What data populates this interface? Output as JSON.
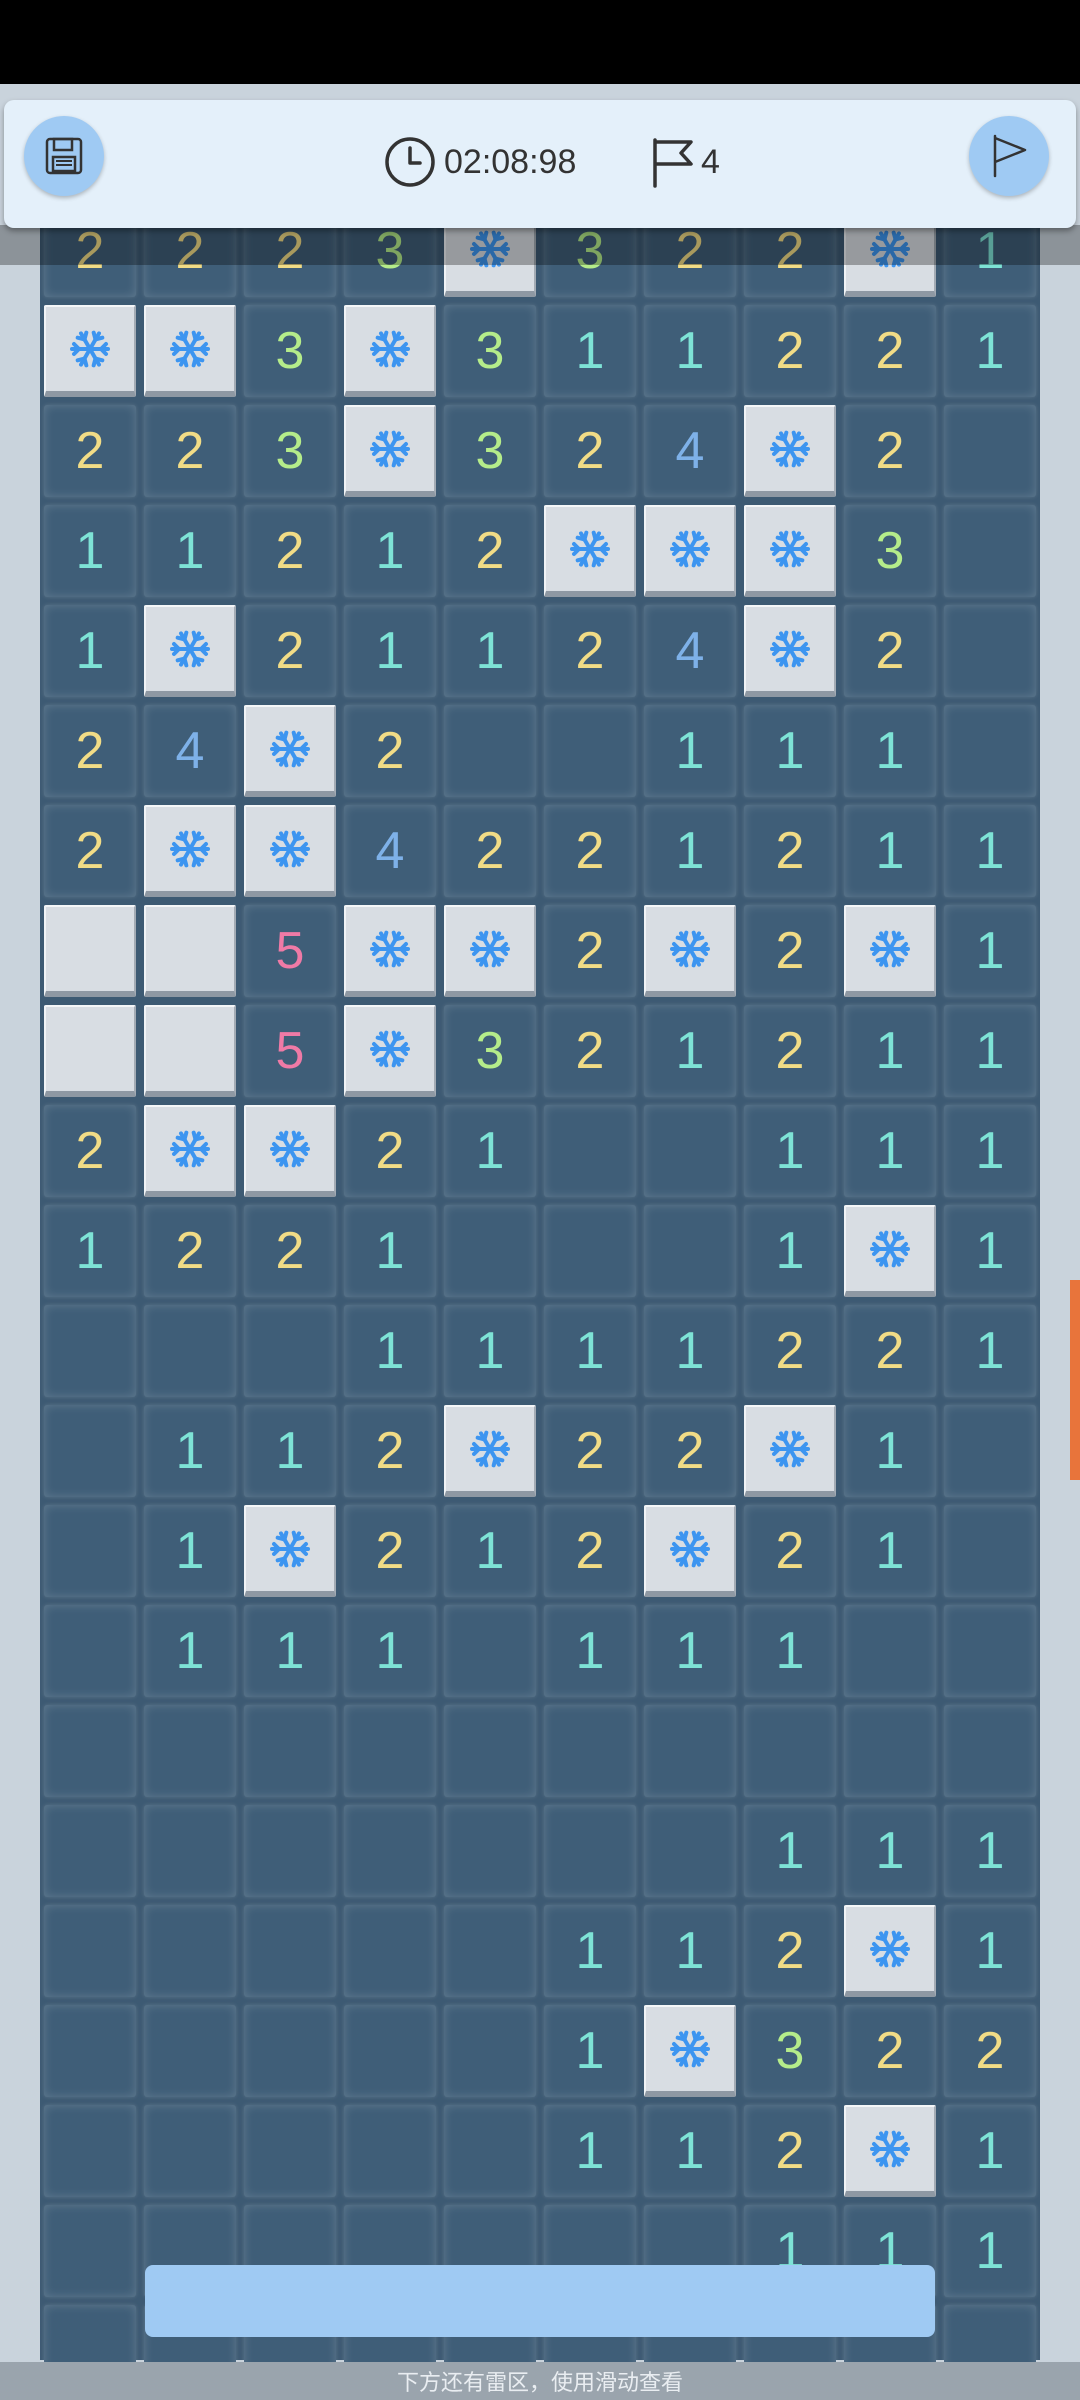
{
  "header": {
    "timer": "02:08:98",
    "flags": "4"
  },
  "board": {
    "cols": 10,
    "rows": [
      [
        "2",
        "2",
        "2",
        "3",
        "M",
        "3",
        "2",
        "2",
        "M",
        "1"
      ],
      [
        "M",
        "M",
        "3",
        "M",
        "3",
        "1",
        "1",
        "2",
        "2",
        "1"
      ],
      [
        "2",
        "2",
        "3",
        "M",
        "3",
        "2",
        "4",
        "M",
        "2",
        ""
      ],
      [
        "1",
        "1",
        "2",
        "1",
        "2",
        "M",
        "M",
        "M",
        "3",
        ""
      ],
      [
        "1",
        "M",
        "2",
        "1",
        "1",
        "2",
        "4",
        "M",
        "2",
        ""
      ],
      [
        "2",
        "4",
        "M",
        "2",
        "",
        "",
        "1",
        "1",
        "1",
        ""
      ],
      [
        "2",
        "M",
        "M",
        "4",
        "2",
        "2",
        "1",
        "2",
        "1",
        "1"
      ],
      [
        "C",
        "C",
        "5",
        "M",
        "M",
        "2",
        "M",
        "2",
        "M",
        "1"
      ],
      [
        "C",
        "C",
        "5",
        "M",
        "3",
        "2",
        "1",
        "2",
        "1",
        "1"
      ],
      [
        "2",
        "M",
        "M",
        "2",
        "1",
        "",
        "",
        "1",
        "1",
        "1"
      ],
      [
        "1",
        "2",
        "2",
        "1",
        "",
        "",
        "",
        "1",
        "M",
        "1"
      ],
      [
        "",
        "",
        "",
        "1",
        "1",
        "1",
        "1",
        "2",
        "2",
        "1"
      ],
      [
        "",
        "1",
        "1",
        "2",
        "M",
        "2",
        "2",
        "M",
        "1",
        ""
      ],
      [
        "",
        "1",
        "M",
        "2",
        "1",
        "2",
        "M",
        "2",
        "1",
        ""
      ],
      [
        "",
        "1",
        "1",
        "1",
        "",
        "1",
        "1",
        "1",
        "",
        ""
      ],
      [
        "",
        "",
        "",
        "",
        "",
        "",
        "",
        "",
        "",
        ""
      ],
      [
        "",
        "",
        "",
        "",
        "",
        "",
        "",
        "1",
        "1",
        "1"
      ],
      [
        "",
        "",
        "",
        "",
        "",
        "1",
        "1",
        "2",
        "M",
        "1"
      ],
      [
        "",
        "",
        "",
        "",
        "",
        "1",
        "M",
        "3",
        "2",
        "2"
      ],
      [
        "",
        "",
        "",
        "",
        "",
        "1",
        "1",
        "2",
        "M",
        "1"
      ],
      [
        "",
        "",
        "",
        "",
        "",
        "",
        "",
        "1",
        "1",
        "1"
      ],
      [
        "",
        "",
        "",
        "",
        "",
        "",
        "",
        "",
        "",
        ""
      ]
    ]
  },
  "footer": {
    "hint": "下方还有雷区，使用滑动查看"
  },
  "colors": {
    "board": "#3d5a73",
    "covered_tile": "#d8dde3",
    "snowflake": "#3d95f0",
    "button": "#9fcaf3"
  }
}
